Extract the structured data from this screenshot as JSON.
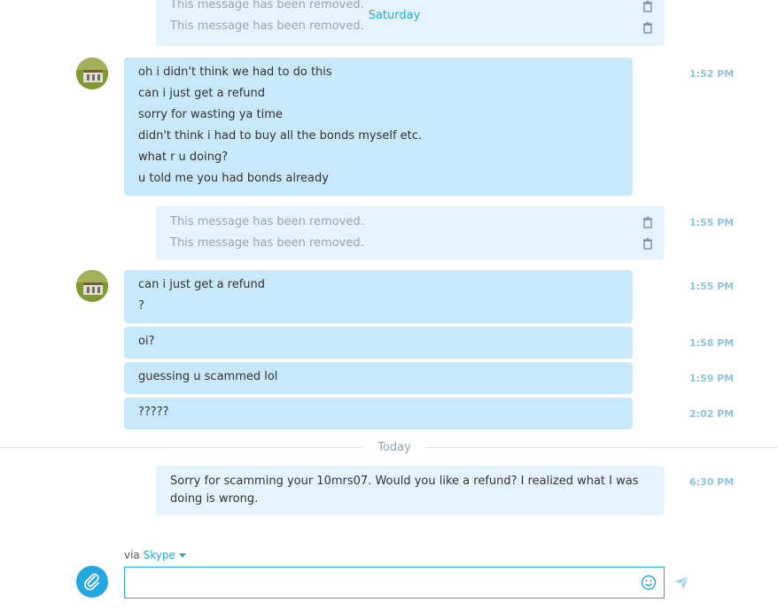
{
  "removed_text": "This message has been removed.",
  "day_labels": {
    "saturday": "Saturday",
    "today": "Today"
  },
  "groups": [
    {
      "lines": [
        "oh i didn't think we had to do this",
        "can i just get a refund",
        "sorry for wasting ya time",
        "didn't think i had to buy all the bonds myself etc.",
        "what r u doing?",
        "u told me you had bonds already"
      ],
      "time": "1:52 PM"
    },
    {
      "removed": [
        "This message has been removed.",
        "This message has been removed."
      ],
      "time": "1:55 PM"
    },
    {
      "lines": [
        "can i just get a refund",
        "?"
      ],
      "time": "1:55 PM"
    },
    {
      "lines": [
        "oi?"
      ],
      "time": "1:58 PM"
    },
    {
      "lines": [
        "guessing u scammed lol"
      ],
      "time": "1:59 PM"
    },
    {
      "lines": [
        "?????"
      ],
      "time": "2:02 PM"
    }
  ],
  "own_message": {
    "text": "Sorry for scamming your 10mrs07. Would you like a refund? I realized what I was doing is wrong.",
    "time": "6:30 PM"
  },
  "composer": {
    "via_prefix": "via",
    "service": "Skype",
    "value": "",
    "placeholder": ""
  },
  "icons": {
    "attach": "paperclip-icon",
    "emoji": "smiley-icon",
    "send": "send-icon",
    "delete": "trash-icon",
    "dropdown": "chevron-down-icon"
  },
  "colors": {
    "accent": "#23a7e0",
    "bubble_incoming": "#c7e9fb",
    "bubble_removed": "#e5f4fc",
    "timestamp": "#8fc3dd"
  }
}
